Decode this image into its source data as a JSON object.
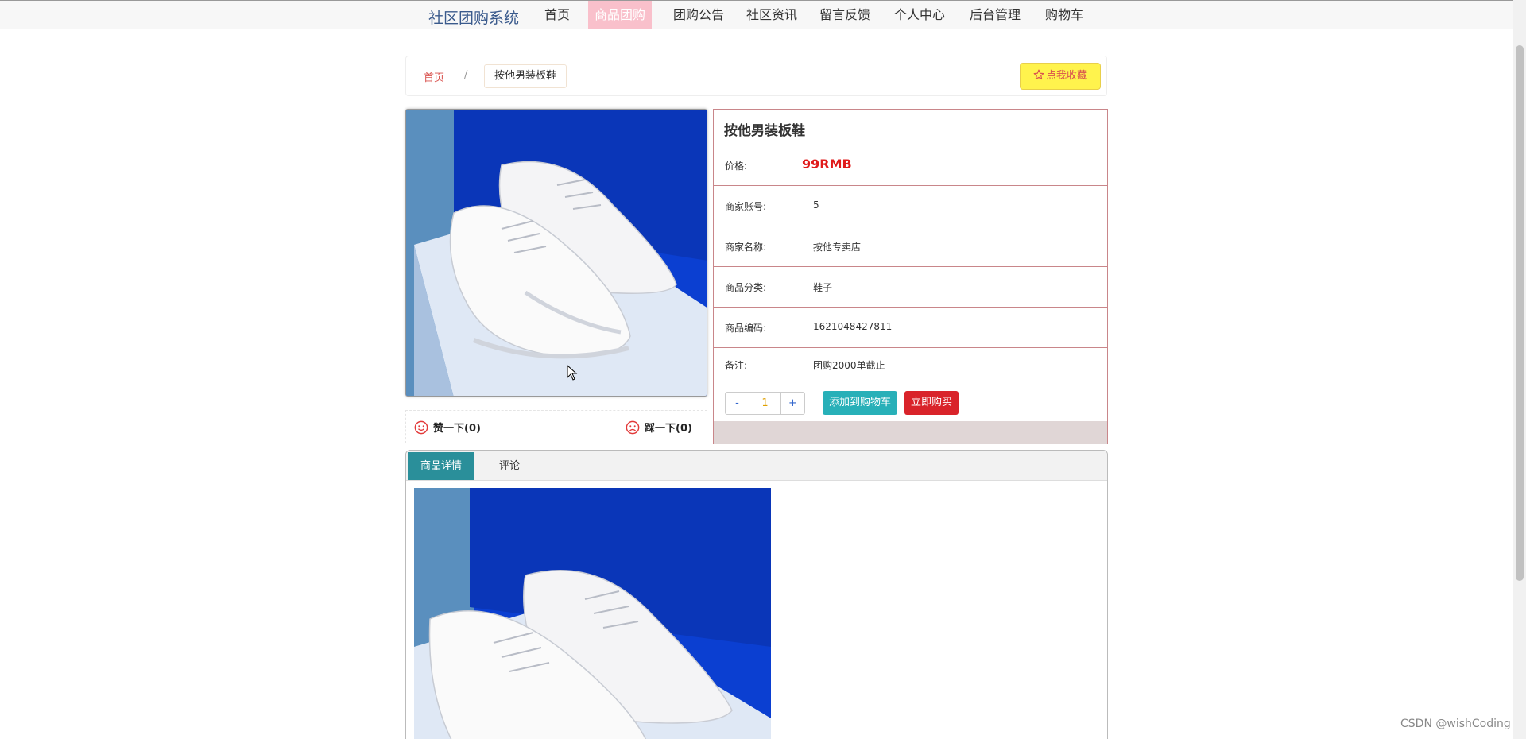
{
  "nav": {
    "brand": "社区团购系统",
    "items": [
      {
        "label": "首页"
      },
      {
        "label": "商品团购"
      },
      {
        "label": "团购公告"
      },
      {
        "label": "社区资讯"
      },
      {
        "label": "留言反馈"
      },
      {
        "label": "个人中心"
      },
      {
        "label": "后台管理"
      },
      {
        "label": "购物车"
      }
    ],
    "active_index": 1
  },
  "breadcrumb": {
    "home": "首页",
    "separator": "/",
    "current": "按他男装板鞋"
  },
  "favorite_button": "点我收藏",
  "product": {
    "title": "按他男装板鞋",
    "price_label": "价格:",
    "price": "99RMB",
    "rows": [
      {
        "label": "商家账号:",
        "value": "5"
      },
      {
        "label": "商家名称:",
        "value": "按他专卖店"
      },
      {
        "label": "商品分类:",
        "value": "鞋子"
      },
      {
        "label": "商品编码:",
        "value": "1621048427811"
      },
      {
        "label": "备注:",
        "value": "团购2000单截止"
      }
    ],
    "quantity": {
      "minus": "-",
      "value": "1",
      "plus": "+"
    },
    "add_to_cart": "添加到购物车",
    "buy_now": "立即购买"
  },
  "votes": {
    "like": "赞一下(0)",
    "dislike": "踩一下(0)"
  },
  "tabs": [
    {
      "label": "商品详情"
    },
    {
      "label": "评论"
    }
  ],
  "colors": {
    "accent_pink": "#f9c0cb",
    "price_red": "#e01b1b",
    "teal": "#28b0b8",
    "buy_red": "#d9232a",
    "fav_yellow": "#fff34d"
  },
  "watermark": "CSDN @wishCoding"
}
